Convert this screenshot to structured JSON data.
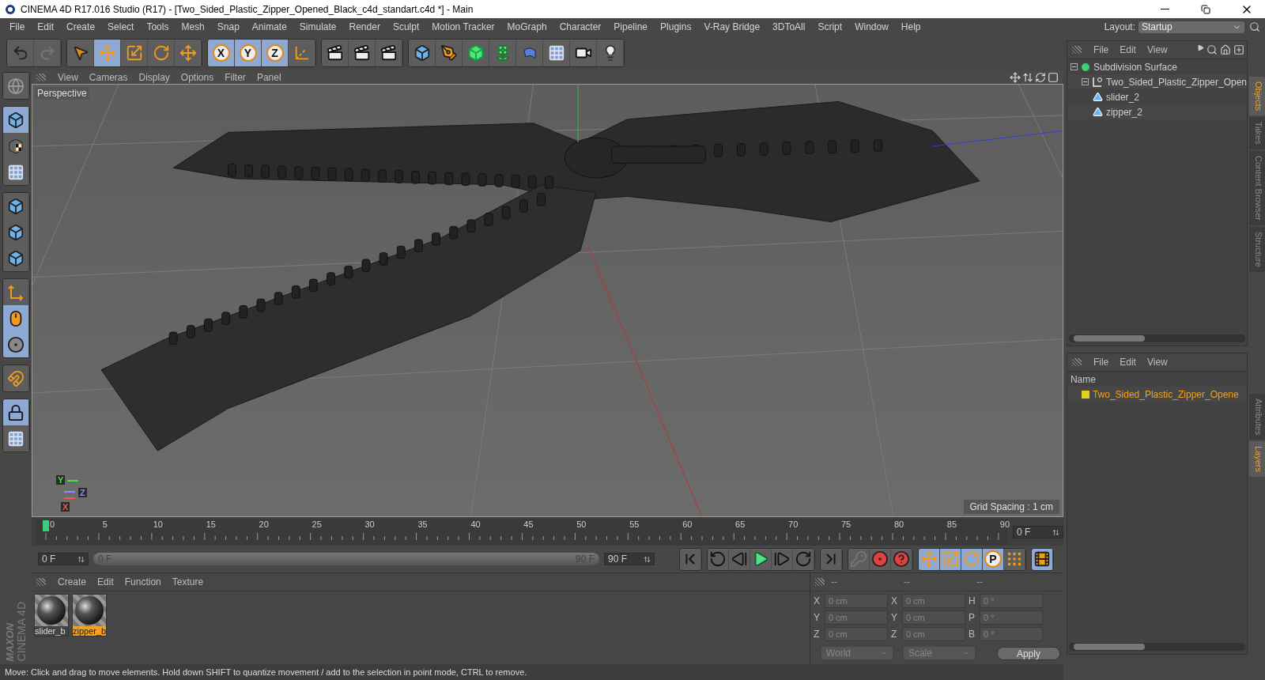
{
  "window": {
    "title": "CINEMA 4D R17.016 Studio (R17) - [Two_Sided_Plastic_Zipper_Opened_Black_c4d_standart.c4d *] - Main"
  },
  "menu": [
    "File",
    "Edit",
    "Create",
    "Select",
    "Tools",
    "Mesh",
    "Snap",
    "Animate",
    "Simulate",
    "Render",
    "Sculpt",
    "Motion Tracker",
    "MoGraph",
    "Character",
    "Pipeline",
    "Plugins",
    "V-Ray Bridge",
    "3DToAll",
    "Script",
    "Window",
    "Help"
  ],
  "layout": {
    "label": "Layout:",
    "value": "Startup"
  },
  "toolbar": [
    {
      "tools": [
        {
          "kind": "undo",
          "selected": false
        },
        {
          "kind": "redo",
          "selected": false
        }
      ]
    },
    {
      "tools": [
        {
          "kind": "select",
          "selected": false
        },
        {
          "kind": "move",
          "selected": true
        },
        {
          "kind": "scale",
          "selected": false
        },
        {
          "kind": "rotate",
          "selected": false
        },
        {
          "kind": "move",
          "selected": false
        }
      ]
    },
    {
      "tools": [
        {
          "kind": "letter",
          "label": "X",
          "selected": true
        },
        {
          "kind": "letter",
          "label": "Y",
          "selected": true
        },
        {
          "kind": "letter",
          "label": "Z",
          "selected": true
        },
        {
          "kind": "coords",
          "selected": false
        }
      ]
    },
    {
      "tools": [
        {
          "kind": "render",
          "selected": false
        },
        {
          "kind": "render",
          "selected": false
        },
        {
          "kind": "render",
          "selected": false
        }
      ]
    },
    {
      "tools": [
        {
          "kind": "cube",
          "selected": false
        },
        {
          "kind": "pen",
          "selected": false
        },
        {
          "kind": "subdiv",
          "selected": false
        },
        {
          "kind": "cloner",
          "selected": false
        },
        {
          "kind": "bend",
          "selected": false
        },
        {
          "kind": "floor",
          "selected": false
        },
        {
          "kind": "camera",
          "selected": false
        },
        {
          "kind": "light",
          "selected": false
        }
      ]
    }
  ],
  "left_tools": [
    {
      "tools": [
        {
          "kind": "globe",
          "selected": false
        }
      ]
    },
    {
      "tools": [
        {
          "kind": "cube",
          "selected": true
        },
        {
          "kind": "texture",
          "selected": false
        },
        {
          "kind": "floor",
          "selected": false
        }
      ]
    },
    {
      "tools": [
        {
          "kind": "cube",
          "selected": false
        },
        {
          "kind": "cube",
          "selected": false
        },
        {
          "kind": "cube",
          "selected": false
        }
      ]
    },
    {
      "tools": [
        {
          "kind": "axis",
          "selected": false
        },
        {
          "kind": "mouse",
          "selected": true
        },
        {
          "kind": "snap",
          "selected": true
        }
      ]
    },
    {
      "tools": [
        {
          "kind": "magnet",
          "selected": false
        }
      ]
    },
    {
      "tools": [
        {
          "kind": "gridlock",
          "selected": true
        },
        {
          "kind": "floor",
          "selected": false
        }
      ]
    }
  ],
  "viewport": {
    "menu": [
      "View",
      "Cameras",
      "Display",
      "Options",
      "Filter",
      "Panel"
    ],
    "camera": "Perspective",
    "grid_spacing": "Grid Spacing : 1 cm",
    "gizmo": [
      {
        "label": "Y",
        "color": "#44e050"
      },
      {
        "label": "Z",
        "color": "#8090ff"
      },
      {
        "label": "X",
        "color": "#ff5050"
      }
    ]
  },
  "timeline": {
    "ticks": [
      "0",
      "5",
      "10",
      "15",
      "20",
      "25",
      "30",
      "35",
      "40",
      "45",
      "50",
      "55",
      "60",
      "65",
      "70",
      "75",
      "80",
      "85",
      "90"
    ],
    "playhead": {
      "level": 0
    },
    "current": "0 F",
    "start": "0 F",
    "range": {
      "level": 1
    },
    "range_start": "0 F",
    "range_end": "90 F",
    "end": "90 F"
  },
  "transport": [
    {
      "tools": [
        {
          "kind": "first",
          "selected": false
        }
      ]
    },
    {
      "tools": [
        {
          "kind": "loopback",
          "selected": false
        },
        {
          "kind": "stepback",
          "selected": false
        },
        {
          "kind": "play",
          "selected": false
        },
        {
          "kind": "stepfwd",
          "selected": false
        },
        {
          "kind": "loopfwd",
          "selected": false
        }
      ]
    },
    {
      "tools": [
        {
          "kind": "last",
          "selected": false
        }
      ]
    },
    {
      "tools": [
        {
          "kind": "key",
          "selected": false
        },
        {
          "kind": "record",
          "selected": false
        },
        {
          "kind": "help",
          "selected": false
        }
      ]
    },
    {
      "tools": [
        {
          "kind": "move",
          "selected": true
        },
        {
          "kind": "scale",
          "selected": true
        },
        {
          "kind": "rotate",
          "selected": true
        },
        {
          "kind": "letter",
          "label": "P",
          "selected": true
        },
        {
          "kind": "dots",
          "selected": false
        }
      ]
    },
    {
      "tools": [
        {
          "kind": "film",
          "selected": true
        }
      ]
    }
  ],
  "materials": {
    "menu": [
      "Create",
      "Edit",
      "Function",
      "Texture"
    ],
    "items": [
      {
        "name": "slider_b",
        "selected": false
      },
      {
        "name": "zipper_b",
        "selected": true
      }
    ]
  },
  "coordinates": {
    "headers": [
      "--",
      "--",
      "--"
    ],
    "rows": [
      [
        {
          "axis": "X",
          "value": "0 cm"
        },
        {
          "axis": "X",
          "value": "0 cm"
        },
        {
          "axis": "H",
          "value": "0 °"
        }
      ],
      [
        {
          "axis": "Y",
          "value": "0 cm"
        },
        {
          "axis": "Y",
          "value": "0 cm"
        },
        {
          "axis": "P",
          "value": "0 °"
        }
      ],
      [
        {
          "axis": "Z",
          "value": "0 cm"
        },
        {
          "axis": "Z",
          "value": "0 cm"
        },
        {
          "axis": "B",
          "value": "0 °"
        }
      ]
    ],
    "dropdowns": [
      "World",
      "Scale"
    ],
    "apply": "Apply"
  },
  "logo": {
    "brand": "MAXON",
    "product": "CINEMA 4D"
  },
  "objects": {
    "menu": [
      "File",
      "Edit",
      "View"
    ],
    "tree": [
      {
        "name": "Subdivision Surface",
        "kind": "subdiv",
        "expanded": true,
        "children": [
          {
            "name": "Two_Sided_Plastic_Zipper_Open",
            "kind": "null",
            "expanded": true,
            "children": [
              {
                "name": "slider_2",
                "kind": "poly"
              },
              {
                "name": "zipper_2",
                "kind": "poly"
              }
            ]
          }
        ]
      }
    ]
  },
  "layers": {
    "menu": [
      "File",
      "Edit",
      "View"
    ],
    "column": "Name",
    "rows": [
      {
        "name": "Two_Sided_Plastic_Zipper_Opene",
        "color": "#e0d020"
      }
    ]
  },
  "side_tabs_top": [
    {
      "label": "Objects",
      "selected": true
    },
    {
      "label": "Takes",
      "selected": false
    },
    {
      "label": "Content Browser",
      "selected": false
    },
    {
      "label": "Structure",
      "selected": false
    }
  ],
  "side_tabs_bottom": [
    {
      "label": "Attributes",
      "selected": false
    },
    {
      "label": "Layers",
      "selected": true
    }
  ],
  "status": "Move: Click and drag to move elements. Hold down SHIFT to quantize movement / add to the selection in point mode, CTRL to remove."
}
